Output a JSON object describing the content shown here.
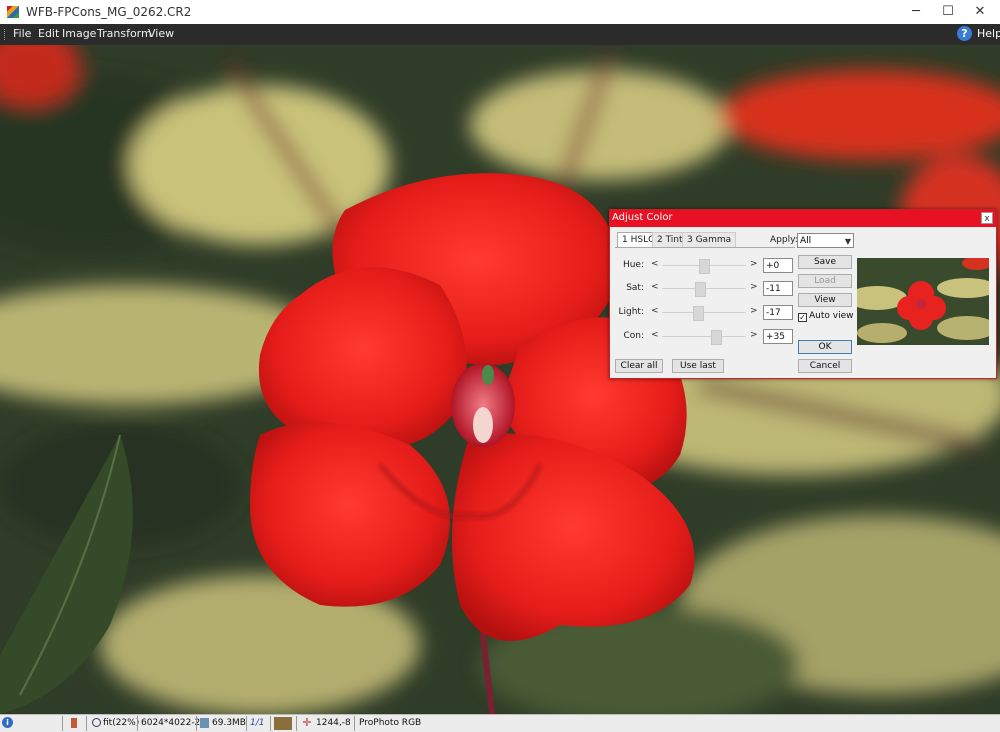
{
  "window": {
    "title": "WFB-FPCons_MG_0262.CR2",
    "minimize": "─",
    "maximize": "☐",
    "close": "✕"
  },
  "menu": {
    "items": [
      "File",
      "Edit",
      "Image",
      "Transform",
      "View"
    ],
    "help_icon_glyph": "?",
    "help_label": "Help"
  },
  "status": {
    "info_glyph": "i",
    "zoom": "fit(22%)",
    "dimensions": "6024*4022-24",
    "memory": "69.3MB",
    "page": "1/1",
    "cursor": "1244,-8",
    "color_profile": "ProPhoto RGB"
  },
  "dialog": {
    "title": "Adjust Color",
    "close_glyph": "x",
    "tabs": [
      "1 HSLC",
      "2 Tint",
      "3 Gamma"
    ],
    "apply_label": "Apply:",
    "apply_value": "All",
    "rows": [
      {
        "label": "Hue:",
        "value": "+0",
        "level": 0.5
      },
      {
        "label": "Sat:",
        "value": "-11",
        "level": 0.45
      },
      {
        "label": "Light:",
        "value": "-17",
        "level": 0.43
      },
      {
        "label": "Con:",
        "value": "+35",
        "level": 0.67
      }
    ],
    "arrow_left": "<",
    "arrow_right": ">",
    "buttons": {
      "save": "Save",
      "load": "Load",
      "view": "View",
      "ok": "OK",
      "cancel": "Cancel",
      "clear_all": "Clear all",
      "use_last": "Use last"
    },
    "auto_view_label": "Auto view",
    "auto_view_checked": true
  },
  "colors": {
    "dialog_title_bg": "#e81123",
    "flower_red": "#e8231f",
    "leaf_green": "#3f4f2f",
    "leaf_yellow": "#c9c27a"
  }
}
